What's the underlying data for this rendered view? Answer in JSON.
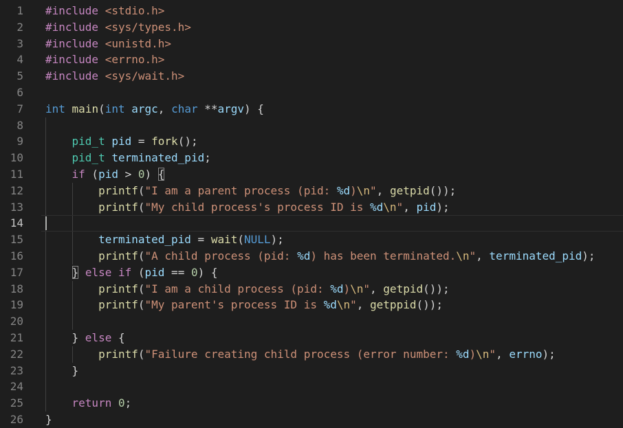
{
  "editor": {
    "language": "c",
    "current_line": 14,
    "lines": [
      {
        "num": "1",
        "tokens": [
          {
            "t": "#include",
            "c": "pp"
          },
          {
            "t": " "
          },
          {
            "t": "<stdio.h>",
            "c": "str"
          }
        ]
      },
      {
        "num": "2",
        "tokens": [
          {
            "t": "#include",
            "c": "pp"
          },
          {
            "t": " "
          },
          {
            "t": "<sys/types.h>",
            "c": "str"
          }
        ]
      },
      {
        "num": "3",
        "tokens": [
          {
            "t": "#include",
            "c": "pp"
          },
          {
            "t": " "
          },
          {
            "t": "<unistd.h>",
            "c": "str"
          }
        ]
      },
      {
        "num": "4",
        "tokens": [
          {
            "t": "#include",
            "c": "pp"
          },
          {
            "t": " "
          },
          {
            "t": "<errno.h>",
            "c": "str"
          }
        ]
      },
      {
        "num": "5",
        "tokens": [
          {
            "t": "#include",
            "c": "pp"
          },
          {
            "t": " "
          },
          {
            "t": "<sys/wait.h>",
            "c": "str"
          }
        ]
      },
      {
        "num": "6",
        "tokens": []
      },
      {
        "num": "7",
        "tokens": [
          {
            "t": "int",
            "c": "kw"
          },
          {
            "t": " "
          },
          {
            "t": "main",
            "c": "fn"
          },
          {
            "t": "("
          },
          {
            "t": "int",
            "c": "kw"
          },
          {
            "t": " "
          },
          {
            "t": "argc",
            "c": "var"
          },
          {
            "t": ", "
          },
          {
            "t": "char",
            "c": "kw"
          },
          {
            "t": " **"
          },
          {
            "t": "argv",
            "c": "var"
          },
          {
            "t": ") {"
          }
        ]
      },
      {
        "num": "8",
        "tokens": []
      },
      {
        "num": "9",
        "tokens": [
          {
            "t": "    "
          },
          {
            "t": "pid_t",
            "c": "ty"
          },
          {
            "t": " "
          },
          {
            "t": "pid",
            "c": "var"
          },
          {
            "t": " = "
          },
          {
            "t": "fork",
            "c": "fn"
          },
          {
            "t": "();"
          }
        ]
      },
      {
        "num": "10",
        "tokens": [
          {
            "t": "    "
          },
          {
            "t": "pid_t",
            "c": "ty"
          },
          {
            "t": " "
          },
          {
            "t": "terminated_pid",
            "c": "var"
          },
          {
            "t": ";"
          }
        ]
      },
      {
        "num": "11",
        "tokens": [
          {
            "t": "    "
          },
          {
            "t": "if",
            "c": "ctl"
          },
          {
            "t": " ("
          },
          {
            "t": "pid",
            "c": "var"
          },
          {
            "t": " > "
          },
          {
            "t": "0",
            "c": "num"
          },
          {
            "t": ") "
          },
          {
            "t": "{",
            "c": "brk"
          }
        ]
      },
      {
        "num": "12",
        "tokens": [
          {
            "t": "        "
          },
          {
            "t": "printf",
            "c": "fn"
          },
          {
            "t": "("
          },
          {
            "t": "\"I am a parent process (pid: ",
            "c": "str"
          },
          {
            "t": "%d",
            "c": "fmt"
          },
          {
            "t": ")",
            "c": "str"
          },
          {
            "t": "\\n",
            "c": "esc"
          },
          {
            "t": "\"",
            "c": "str"
          },
          {
            "t": ", "
          },
          {
            "t": "getpid",
            "c": "fn"
          },
          {
            "t": "());"
          }
        ]
      },
      {
        "num": "13",
        "tokens": [
          {
            "t": "        "
          },
          {
            "t": "printf",
            "c": "fn"
          },
          {
            "t": "("
          },
          {
            "t": "\"My child process's process ID is ",
            "c": "str"
          },
          {
            "t": "%d",
            "c": "fmt"
          },
          {
            "t": "\\n",
            "c": "esc"
          },
          {
            "t": "\"",
            "c": "str"
          },
          {
            "t": ", "
          },
          {
            "t": "pid",
            "c": "var"
          },
          {
            "t": ");"
          }
        ]
      },
      {
        "num": "14",
        "tokens": []
      },
      {
        "num": "15",
        "tokens": [
          {
            "t": "        "
          },
          {
            "t": "terminated_pid",
            "c": "var"
          },
          {
            "t": " = "
          },
          {
            "t": "wait",
            "c": "fn"
          },
          {
            "t": "("
          },
          {
            "t": "NULL",
            "c": "mac"
          },
          {
            "t": ");"
          }
        ]
      },
      {
        "num": "16",
        "tokens": [
          {
            "t": "        "
          },
          {
            "t": "printf",
            "c": "fn"
          },
          {
            "t": "("
          },
          {
            "t": "\"A child process (pid: ",
            "c": "str"
          },
          {
            "t": "%d",
            "c": "fmt"
          },
          {
            "t": ") has been terminated.",
            "c": "str"
          },
          {
            "t": "\\n",
            "c": "esc"
          },
          {
            "t": "\"",
            "c": "str"
          },
          {
            "t": ", "
          },
          {
            "t": "terminated_pid",
            "c": "var"
          },
          {
            "t": ");"
          }
        ]
      },
      {
        "num": "17",
        "tokens": [
          {
            "t": "    "
          },
          {
            "t": "}",
            "c": "brk"
          },
          {
            "t": " "
          },
          {
            "t": "else",
            "c": "ctl"
          },
          {
            "t": " "
          },
          {
            "t": "if",
            "c": "ctl"
          },
          {
            "t": " ("
          },
          {
            "t": "pid",
            "c": "var"
          },
          {
            "t": " == "
          },
          {
            "t": "0",
            "c": "num"
          },
          {
            "t": ") {"
          }
        ]
      },
      {
        "num": "18",
        "tokens": [
          {
            "t": "        "
          },
          {
            "t": "printf",
            "c": "fn"
          },
          {
            "t": "("
          },
          {
            "t": "\"I am a child process (pid: ",
            "c": "str"
          },
          {
            "t": "%d",
            "c": "fmt"
          },
          {
            "t": ")",
            "c": "str"
          },
          {
            "t": "\\n",
            "c": "esc"
          },
          {
            "t": "\"",
            "c": "str"
          },
          {
            "t": ", "
          },
          {
            "t": "getpid",
            "c": "fn"
          },
          {
            "t": "());"
          }
        ]
      },
      {
        "num": "19",
        "tokens": [
          {
            "t": "        "
          },
          {
            "t": "printf",
            "c": "fn"
          },
          {
            "t": "("
          },
          {
            "t": "\"My parent's process ID is ",
            "c": "str"
          },
          {
            "t": "%d",
            "c": "fmt"
          },
          {
            "t": "\\n",
            "c": "esc"
          },
          {
            "t": "\"",
            "c": "str"
          },
          {
            "t": ", "
          },
          {
            "t": "getppid",
            "c": "fn"
          },
          {
            "t": "());"
          }
        ]
      },
      {
        "num": "20",
        "tokens": []
      },
      {
        "num": "21",
        "tokens": [
          {
            "t": "    "
          },
          {
            "t": "} "
          },
          {
            "t": "else",
            "c": "ctl"
          },
          {
            "t": " {"
          }
        ]
      },
      {
        "num": "22",
        "tokens": [
          {
            "t": "        "
          },
          {
            "t": "printf",
            "c": "fn"
          },
          {
            "t": "("
          },
          {
            "t": "\"Failure creating child process (error number: ",
            "c": "str"
          },
          {
            "t": "%d",
            "c": "fmt"
          },
          {
            "t": ")",
            "c": "str"
          },
          {
            "t": "\\n",
            "c": "esc"
          },
          {
            "t": "\"",
            "c": "str"
          },
          {
            "t": ", "
          },
          {
            "t": "errno",
            "c": "var"
          },
          {
            "t": ");"
          }
        ]
      },
      {
        "num": "23",
        "tokens": [
          {
            "t": "    "
          },
          {
            "t": "}"
          }
        ]
      },
      {
        "num": "24",
        "tokens": []
      },
      {
        "num": "25",
        "tokens": [
          {
            "t": "    "
          },
          {
            "t": "return",
            "c": "ctl"
          },
          {
            "t": " "
          },
          {
            "t": "0",
            "c": "num"
          },
          {
            "t": ";"
          }
        ]
      },
      {
        "num": "26",
        "tokens": [
          {
            "t": "}"
          }
        ]
      }
    ]
  },
  "colors": {
    "background": "#1e1e1e",
    "line_number": "#858585",
    "text": "#d4d4d4",
    "keyword": "#569cd6",
    "control": "#c586c0",
    "function": "#dcdcaa",
    "type": "#4ec9b0",
    "variable": "#9cdcfe",
    "string": "#ce9178",
    "number": "#b5cea8"
  }
}
